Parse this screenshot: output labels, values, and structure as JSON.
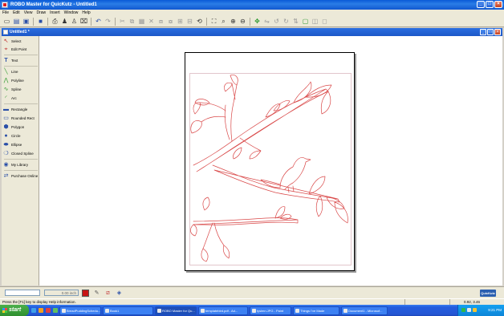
{
  "window": {
    "title": "ROBO Master for QuicKutz - Untitled1"
  },
  "menu": [
    "File",
    "Edit",
    "View",
    "Draw",
    "Insert",
    "Window",
    "Help"
  ],
  "document": {
    "title": "Untitled1 *"
  },
  "tools": [
    {
      "label": "Select",
      "icon": "arrow-cursor-icon"
    },
    {
      "label": "Edit Point",
      "icon": "edit-point-icon"
    },
    {
      "label": "Text",
      "icon": "text-icon"
    },
    {
      "label": "Line",
      "icon": "line-icon"
    },
    {
      "label": "Polyline",
      "icon": "polyline-icon"
    },
    {
      "label": "Spline",
      "icon": "spline-icon"
    },
    {
      "label": "Arc",
      "icon": "arc-icon"
    },
    {
      "label": "Rectangle",
      "icon": "rectangle-icon"
    },
    {
      "label": "Rounded Rect",
      "icon": "rounded-rect-icon"
    },
    {
      "label": "Polygon",
      "icon": "polygon-icon"
    },
    {
      "label": "Circle",
      "icon": "circle-icon"
    },
    {
      "label": "Ellipse",
      "icon": "ellipse-icon"
    },
    {
      "label": "Closed Spline",
      "icon": "closed-spline-icon"
    },
    {
      "label": "My Library",
      "icon": "library-icon"
    },
    {
      "label": "Purchase Online",
      "icon": "purchase-icon"
    }
  ],
  "bottom": {
    "line_width": "0.00 inch",
    "color": "#c81414",
    "logo": "QuicKutz"
  },
  "status": {
    "help_text": "Press the [F1] key to display Help information.",
    "coords": "0.92, 3.46"
  },
  "taskbar": {
    "start": "start",
    "tasks": [
      "BreadPuddingSchedu...",
      "Book1",
      "ROBO Master for Qu...",
      "templatebird.pdf - Ad...",
      "tysimn.JPG - Paint",
      "Things I've Made",
      "Document1 - Microsof..."
    ],
    "active_task_index": 2,
    "clock": "9:21 PM"
  },
  "colors": {
    "accent": "#245ede",
    "cut_line": "#d94848"
  }
}
